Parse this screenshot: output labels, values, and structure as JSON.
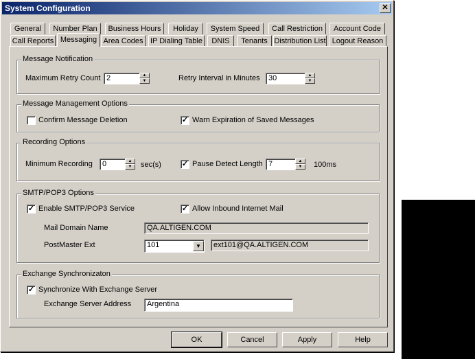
{
  "window": {
    "title": "System Configuration",
    "close_glyph": "✕"
  },
  "tabs_row1": [
    "General",
    "Number Plan",
    "Business Hours",
    "Holiday",
    "System Speed",
    "Call Restriction",
    "Account Code"
  ],
  "tabs_row2": [
    "Call Reports",
    "Messaging",
    "Area Codes",
    "IP Dialing Table",
    "DNIS",
    "Tenants",
    "Distribution List",
    "Logout Reason"
  ],
  "active_tab": "Messaging",
  "message_notification": {
    "title": "Message Notification",
    "max_retry_label": "Maximum Retry Count",
    "max_retry_value": "2",
    "retry_interval_label": "Retry Interval in Minutes",
    "retry_interval_value": "30"
  },
  "message_management": {
    "title": "Message Management Options",
    "confirm_deletion_label": "Confirm Message Deletion",
    "confirm_deletion_checked": false,
    "warn_expiration_label": "Warn Expiration of Saved Messages",
    "warn_expiration_checked": true
  },
  "recording": {
    "title": "Recording Options",
    "min_recording_label": "Minimum Recording",
    "min_recording_value": "0",
    "min_recording_unit": "sec(s)",
    "pause_detect_label": "Pause Detect Length",
    "pause_detect_checked": true,
    "pause_detect_value": "7",
    "pause_detect_unit": "100ms"
  },
  "smtp": {
    "title": "SMTP/POP3 Options",
    "enable_label": "Enable SMTP/POP3 Service",
    "enable_checked": true,
    "allow_inbound_label": "Allow Inbound Internet Mail",
    "allow_inbound_checked": true,
    "mail_domain_label": "Mail Domain Name",
    "mail_domain_value": "QA.ALTIGEN.COM",
    "postmaster_label": "PostMaster Ext",
    "postmaster_value": "101",
    "postmaster_email": "ext101@QA.ALTIGEN.COM"
  },
  "exchange": {
    "title": "Exchange Synchronizaton",
    "sync_label": "Synchronize With Exchange Server",
    "sync_checked": true,
    "server_address_label": "Exchange Server Address",
    "server_address_value": "Argentina"
  },
  "buttons": {
    "ok": "OK",
    "cancel": "Cancel",
    "apply": "Apply",
    "help": "Help"
  },
  "glyphs": {
    "check": "✓",
    "up": "▲",
    "down": "▼"
  }
}
